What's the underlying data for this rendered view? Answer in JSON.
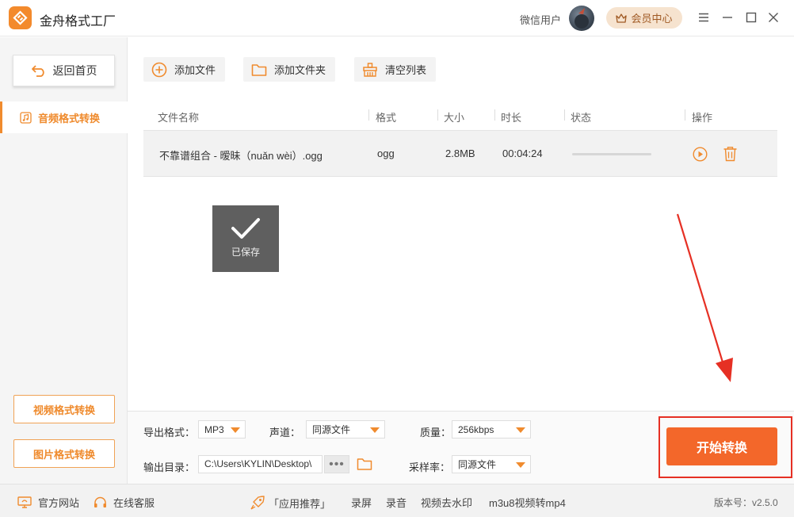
{
  "app": {
    "title": "金舟格式工厂"
  },
  "titlebar": {
    "username": "微信用户",
    "vip_label": "会员中心"
  },
  "sidebar": {
    "back_label": "返回首页",
    "active_item": "音频格式转换",
    "video_button": "视频格式转换",
    "image_button": "图片格式转换"
  },
  "toolbar": {
    "add_file": "添加文件",
    "add_folder": "添加文件夹",
    "clear_list": "清空列表"
  },
  "table": {
    "headers": [
      "文件名称",
      "格式",
      "大小",
      "时长",
      "状态",
      "操作"
    ],
    "rows": [
      {
        "name": "不靠谱组合 - 暧昧（nuǎn wèi）.ogg",
        "format": "ogg",
        "size": "2.8MB",
        "duration": "00:04:24",
        "progress": 0
      }
    ]
  },
  "toast": {
    "label": "已保存"
  },
  "settings": {
    "export_format_label": "导出格式：",
    "export_format_value": "MP3",
    "channel_label": "声道：",
    "channel_value": "同源文件",
    "quality_label": "质量：",
    "quality_value": "256kbps",
    "output_dir_label": "输出目录：",
    "output_dir_value": "C:\\Users\\KYLIN\\Desktop\\",
    "browse_dots": "•••",
    "sample_rate_label": "采样率：",
    "sample_rate_value": "同源文件"
  },
  "start_button": "开始转换",
  "footer": {
    "official_site": "官方网站",
    "online_service": "在线客服",
    "app_recommend": "「应用推荐」",
    "links": [
      "录屏",
      "录音",
      "视频去水印",
      "m3u8视频转mp4"
    ],
    "version": "版本号：v2.5.0"
  },
  "colors": {
    "accent": "#f08b2e",
    "start": "#f3672a",
    "highlight": "#e63024"
  }
}
